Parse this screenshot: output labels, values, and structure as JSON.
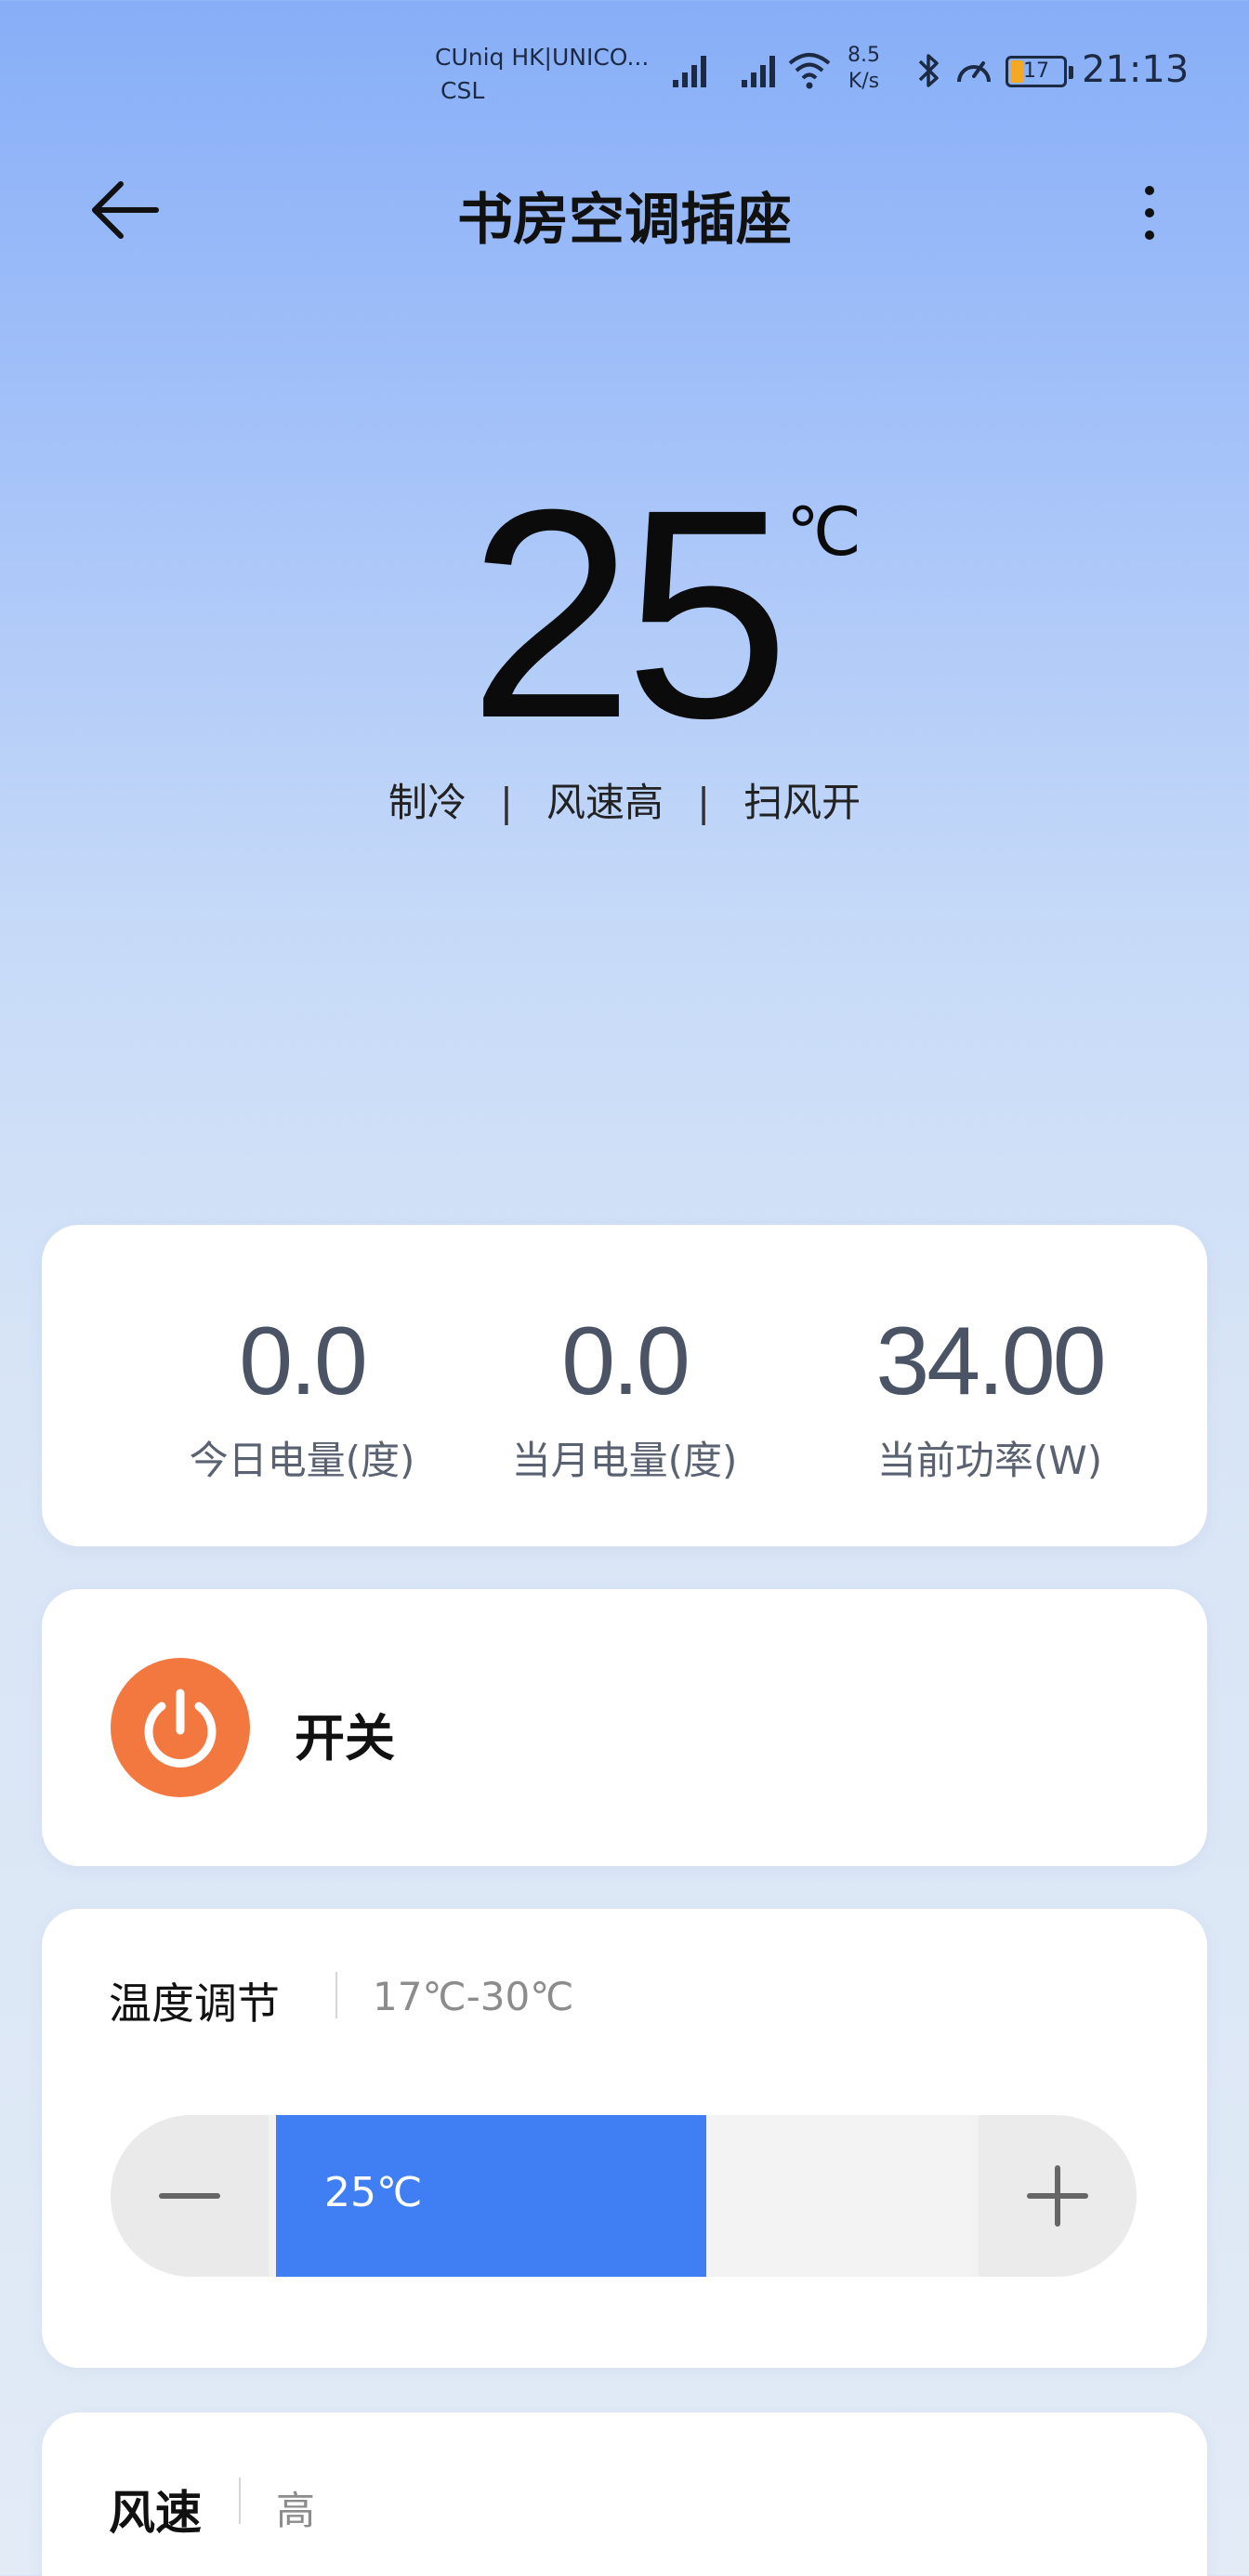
{
  "status_bar": {
    "carrier_line1": "CUniq HK|UNICO...",
    "carrier_line2": "CSL",
    "net_speed_value": "8.5",
    "net_speed_unit": "K/s",
    "battery_level": "17",
    "battery_color": "#f3a826",
    "time": "21:13"
  },
  "header": {
    "back_icon": "arrow-left-icon",
    "title": "书房空调插座",
    "more_icon": "more-vertical-icon"
  },
  "hero": {
    "temperature": "25",
    "unit": "℃",
    "mode": "制冷",
    "separator": "|",
    "fan": "风速高",
    "swing": "扫风开"
  },
  "energy": {
    "stats": [
      {
        "value": "0.0",
        "label": "今日电量(度)"
      },
      {
        "value": "0.0",
        "label": "当月电量(度)"
      },
      {
        "value": "34.00",
        "label": "当前功率(W)"
      }
    ]
  },
  "power": {
    "label": "开关",
    "icon": "power-icon",
    "accent_color": "#f37840"
  },
  "temperature_control": {
    "title": "温度调节",
    "range": "17℃-30℃",
    "current": "25℃",
    "fill_fraction": 0.62,
    "accent_color": "#3f7ef3",
    "minus_icon": "minus-icon",
    "plus_icon": "plus-icon"
  },
  "fan_speed": {
    "title": "风速",
    "value": "高"
  }
}
